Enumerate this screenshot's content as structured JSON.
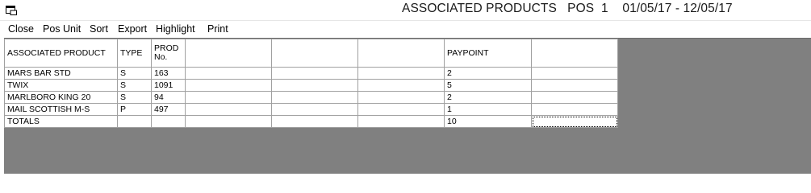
{
  "window": {
    "title": "ASSOCIATED PRODUCTS   POS  1    01/05/17 - 12/05/17",
    "icon": "application-window-icon"
  },
  "menu": {
    "items": [
      {
        "label": "Close"
      },
      {
        "label": "Pos Unit"
      },
      {
        "label": "Sort"
      },
      {
        "label": "Export"
      },
      {
        "label": "Highlight"
      },
      {
        "label": "Print"
      }
    ]
  },
  "grid": {
    "headers": [
      {
        "line1": "ASSOCIATED PRODUCT",
        "line2": ""
      },
      {
        "line1": "TYPE",
        "line2": ""
      },
      {
        "line1": "PROD",
        "line2": "No."
      },
      {
        "line1": "",
        "line2": ""
      },
      {
        "line1": "",
        "line2": ""
      },
      {
        "line1": "",
        "line2": ""
      },
      {
        "line1": "PAYPOINT",
        "line2": ""
      },
      {
        "line1": "",
        "line2": ""
      }
    ],
    "rows": [
      [
        "MARS BAR STD",
        "S",
        "163",
        "",
        "",
        "",
        "2",
        ""
      ],
      [
        "TWIX",
        "S",
        "1091",
        "",
        "",
        "",
        "5",
        ""
      ],
      [
        "MARLBORO KING 20",
        "S",
        "94",
        "",
        "",
        "",
        "2",
        ""
      ],
      [
        "MAIL SCOTTISH M-S",
        "P",
        "497",
        "",
        "",
        "",
        "1",
        ""
      ],
      [
        "TOTALS",
        "",
        "",
        "",
        "",
        "",
        "10",
        ""
      ]
    ]
  },
  "colors": {
    "workspace_background": "#808080",
    "grid_background": "#ffffff",
    "grid_lines": "#a0a0a0"
  }
}
